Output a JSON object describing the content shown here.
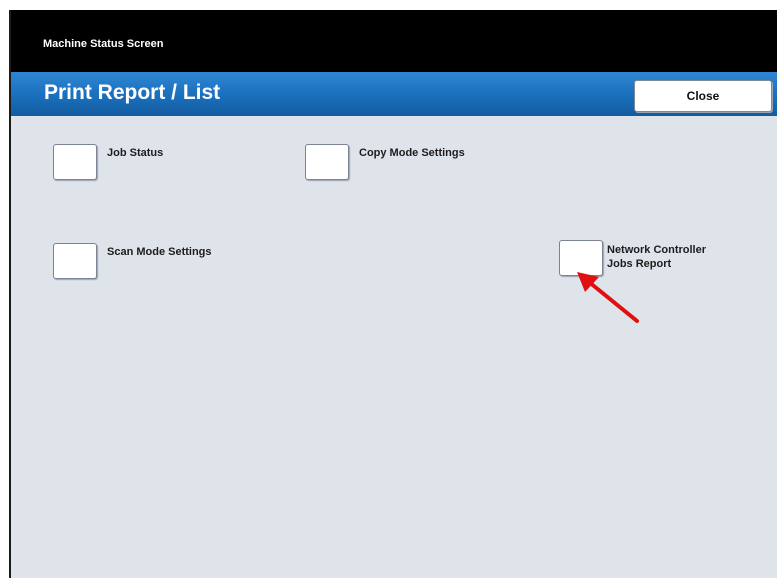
{
  "status_bar": {
    "title": "Machine Status Screen"
  },
  "header": {
    "title": "Print Report / List",
    "close_label": "Close"
  },
  "options": [
    {
      "label": "Job Status"
    },
    {
      "label": "Copy Mode Settings"
    },
    {
      "label": "Scan Mode Settings"
    },
    {
      "label_line1": "Network Controller",
      "label_line2": "Jobs Report"
    }
  ],
  "colors": {
    "title_bar": "#1a6fbc",
    "panel": "#dfe3ea",
    "annotation_arrow": "#e01010"
  },
  "annotation": {
    "icon": "pointer-arrow-icon"
  }
}
